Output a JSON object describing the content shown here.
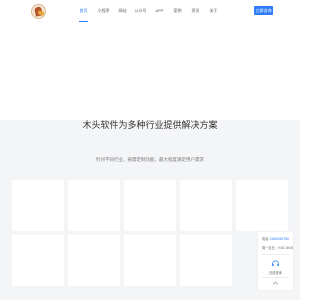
{
  "nav": {
    "items": [
      {
        "label": "首页",
        "active": true
      },
      {
        "label": "小程序",
        "active": false
      },
      {
        "label": "网站",
        "active": false
      },
      {
        "label": "公众号",
        "active": false
      },
      {
        "label": "APP",
        "active": false
      },
      {
        "label": "案例",
        "active": false
      },
      {
        "label": "资讯",
        "active": false
      },
      {
        "label": "关于",
        "active": false
      }
    ],
    "login_label": "立即咨询"
  },
  "section": {
    "title": "木头软件为多种行业提供解决方案",
    "subtitle": "针对不同行业，按需定制功能，最大程度满足用户需求"
  },
  "float_panel": {
    "phone_label": "电话:",
    "phone_number": "13660362785",
    "hours": "周一至日：9:00-18:00",
    "service_label": "在线咨询",
    "service_icon": "headset-icon",
    "top_icon": "arrow-up-icon"
  },
  "colors": {
    "accent": "#2f7df6",
    "section_bg": "#f4f5f7"
  }
}
